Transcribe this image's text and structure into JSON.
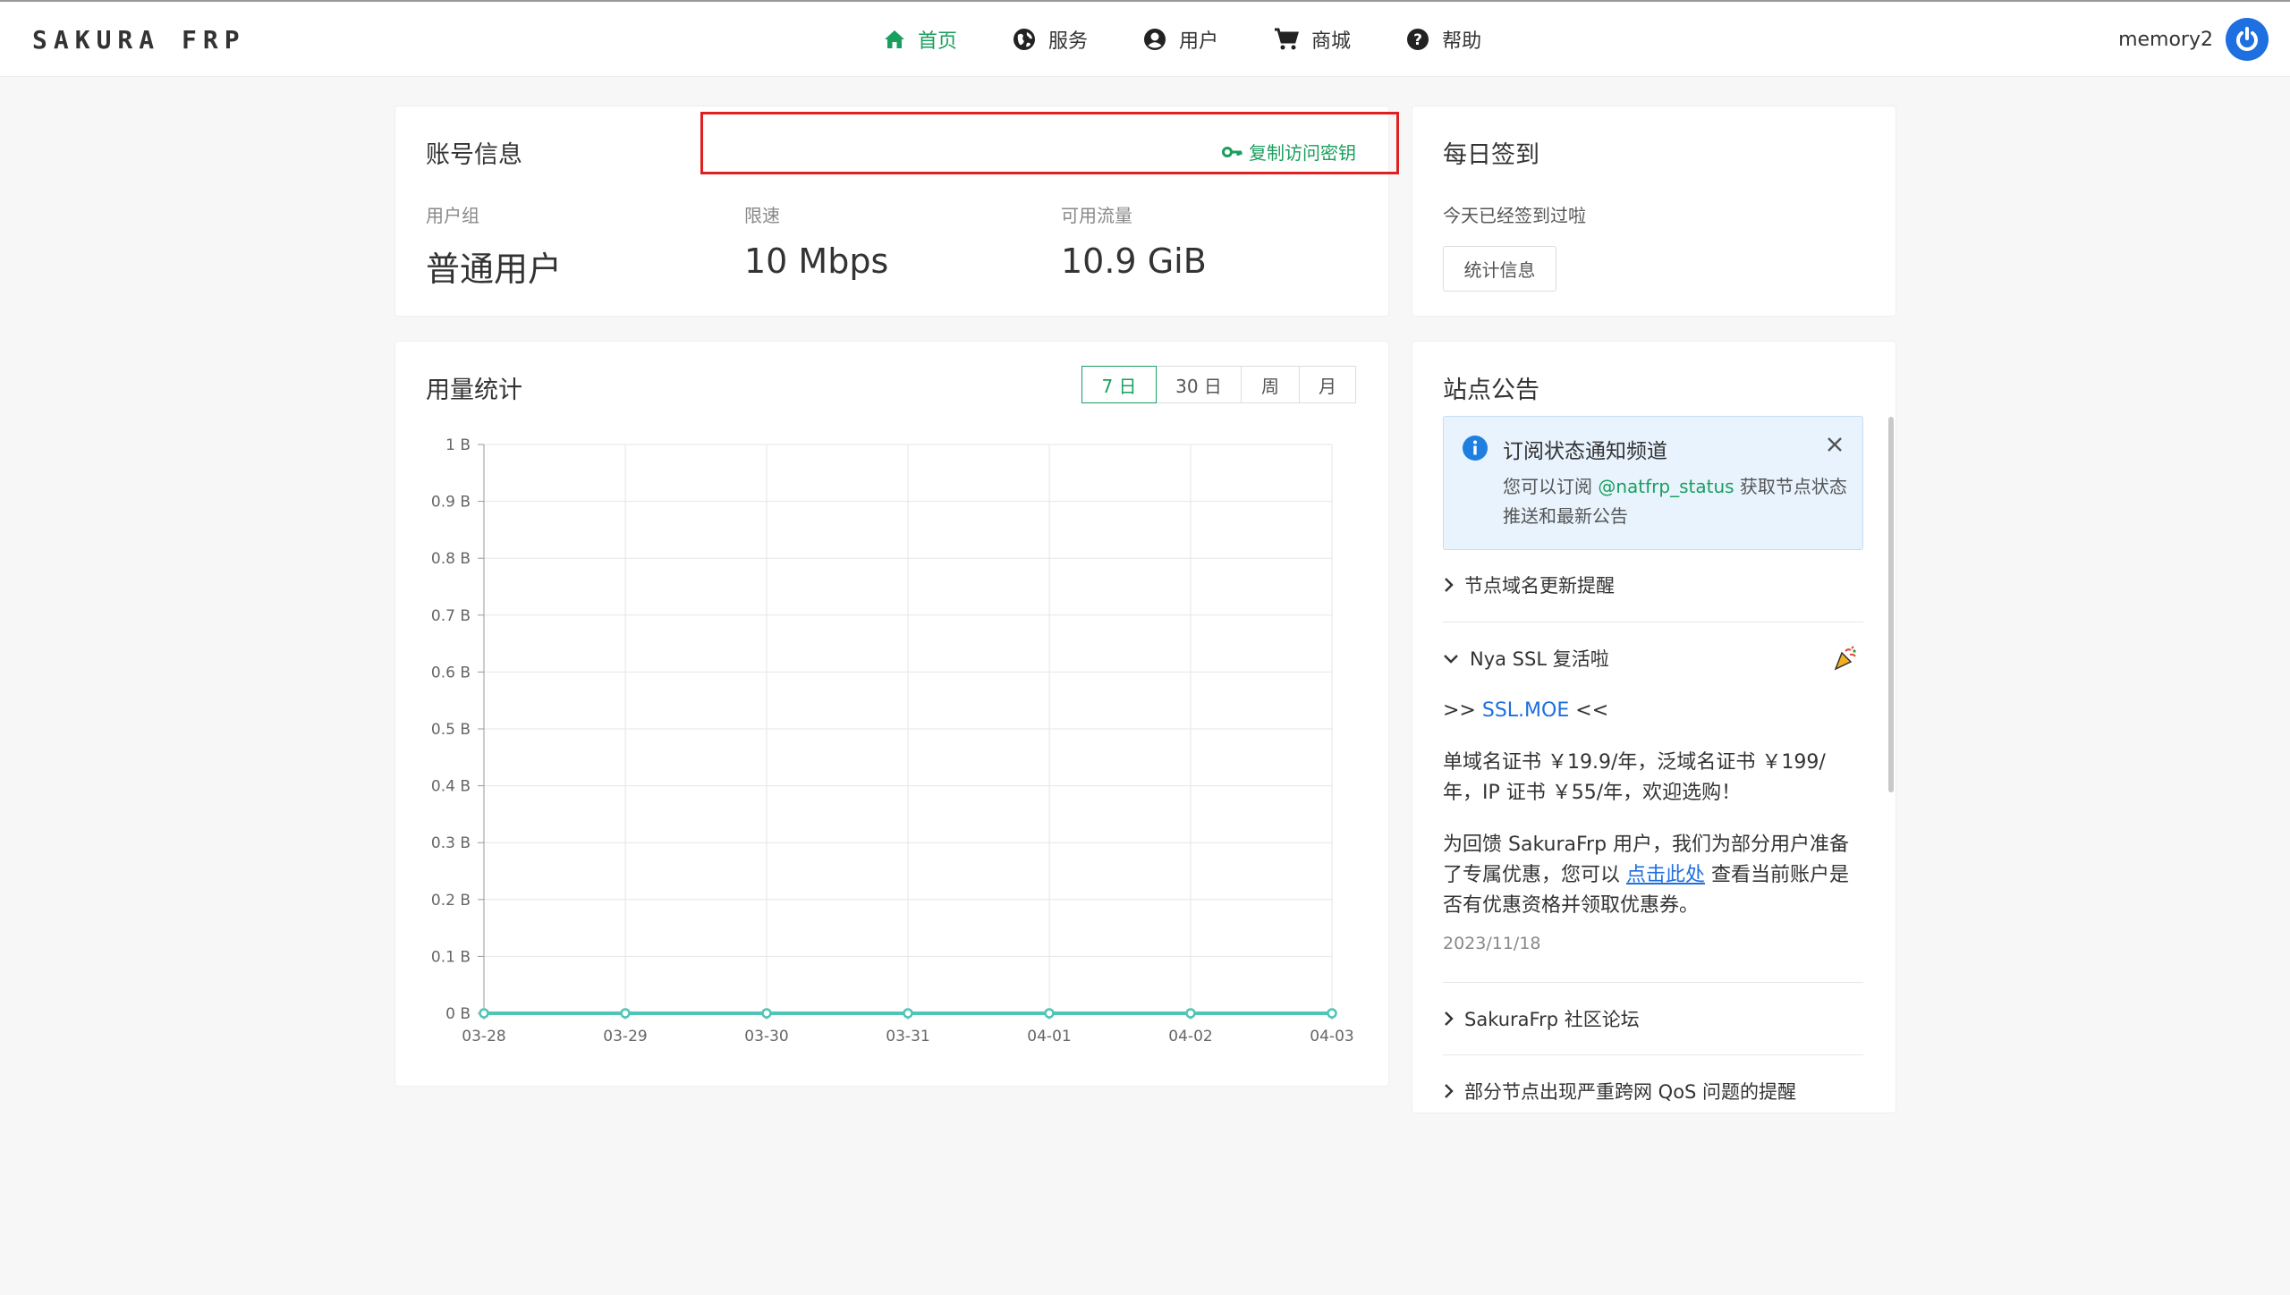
{
  "app": {
    "logo": "SAKURA FRP"
  },
  "nav": {
    "items": [
      {
        "label": "首页",
        "icon": "home-icon",
        "active": true
      },
      {
        "label": "服务",
        "icon": "globe-icon",
        "active": false
      },
      {
        "label": "用户",
        "icon": "user-circle-icon",
        "active": false
      },
      {
        "label": "商城",
        "icon": "cart-icon",
        "active": false
      },
      {
        "label": "帮助",
        "icon": "help-icon",
        "active": false
      }
    ]
  },
  "user": {
    "name": "memory2"
  },
  "account": {
    "title": "账号信息",
    "copy_key": "复制访问密钥",
    "stats": [
      {
        "label": "用户组",
        "value": "普通用户"
      },
      {
        "label": "限速",
        "value": "10 Mbps"
      },
      {
        "label": "可用流量",
        "value": "10.9 GiB"
      }
    ]
  },
  "checkin": {
    "title": "每日签到",
    "status": "今天已经签到过啦",
    "button": "统计信息"
  },
  "usage": {
    "title": "用量统计",
    "ranges": [
      "7 日",
      "30 日",
      "周",
      "月"
    ],
    "active_range": "7 日"
  },
  "chart_data": {
    "type": "line",
    "categories": [
      "03-28",
      "03-29",
      "03-30",
      "03-31",
      "04-01",
      "04-02",
      "04-03"
    ],
    "values": [
      0,
      0,
      0,
      0,
      0,
      0,
      0
    ],
    "yticks": [
      "0 B",
      "0.1 B",
      "0.2 B",
      "0.3 B",
      "0.4 B",
      "0.5 B",
      "0.6 B",
      "0.7 B",
      "0.8 B",
      "0.9 B",
      "1 B"
    ],
    "ylim": [
      0,
      1
    ],
    "grid": true,
    "color": "#4ec5b5"
  },
  "notice": {
    "title": "站点公告",
    "alert": {
      "title": "订阅状态通知频道",
      "body_prefix": "您可以订阅 ",
      "handle": "@natfrp_status",
      "body_suffix": " 获取节点状态推送和最新公告"
    },
    "items": {
      "domain_update": "节点域名更新提醒",
      "nya_ssl": "Nya SSL 复活啦",
      "forum": "SakuraFrp 社区论坛",
      "qos": "部分节点出现严重跨网 QoS 问题的提醒"
    },
    "ssl": {
      "prefix": ">> ",
      "link": "SSL.MOE",
      "suffix": " <<",
      "price_text": "单域名证书 ￥19.9/年，泛域名证书 ￥199/年，IP 证书 ￥55/年，欢迎选购！",
      "promo_prefix": "为回馈 SakuraFrp 用户，我们为部分用户准备了专属优惠，您可以 ",
      "promo_link": "点击此处",
      "promo_suffix": " 查看当前账户是否有优惠资格并领取优惠券。",
      "date": "2023/11/18"
    }
  },
  "colors": {
    "accent": "#1a9e5e",
    "link": "#1e6fe0",
    "highlight": "#e02020"
  }
}
